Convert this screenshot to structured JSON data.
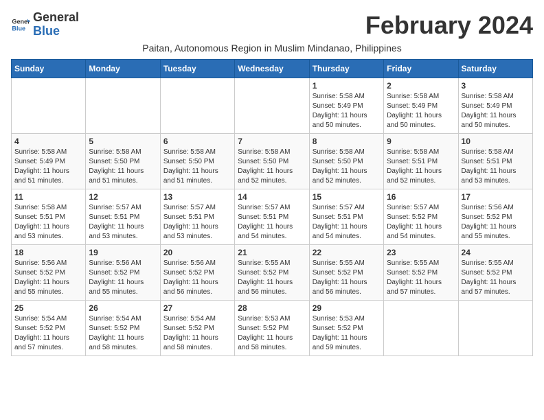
{
  "logo": {
    "general": "General",
    "blue": "Blue"
  },
  "month_title": "February 2024",
  "subtitle": "Paitan, Autonomous Region in Muslim Mindanao, Philippines",
  "days_of_week": [
    "Sunday",
    "Monday",
    "Tuesday",
    "Wednesday",
    "Thursday",
    "Friday",
    "Saturday"
  ],
  "weeks": [
    [
      {
        "num": "",
        "detail": ""
      },
      {
        "num": "",
        "detail": ""
      },
      {
        "num": "",
        "detail": ""
      },
      {
        "num": "",
        "detail": ""
      },
      {
        "num": "1",
        "detail": "Sunrise: 5:58 AM\nSunset: 5:49 PM\nDaylight: 11 hours\nand 50 minutes."
      },
      {
        "num": "2",
        "detail": "Sunrise: 5:58 AM\nSunset: 5:49 PM\nDaylight: 11 hours\nand 50 minutes."
      },
      {
        "num": "3",
        "detail": "Sunrise: 5:58 AM\nSunset: 5:49 PM\nDaylight: 11 hours\nand 50 minutes."
      }
    ],
    [
      {
        "num": "4",
        "detail": "Sunrise: 5:58 AM\nSunset: 5:49 PM\nDaylight: 11 hours\nand 51 minutes."
      },
      {
        "num": "5",
        "detail": "Sunrise: 5:58 AM\nSunset: 5:50 PM\nDaylight: 11 hours\nand 51 minutes."
      },
      {
        "num": "6",
        "detail": "Sunrise: 5:58 AM\nSunset: 5:50 PM\nDaylight: 11 hours\nand 51 minutes."
      },
      {
        "num": "7",
        "detail": "Sunrise: 5:58 AM\nSunset: 5:50 PM\nDaylight: 11 hours\nand 52 minutes."
      },
      {
        "num": "8",
        "detail": "Sunrise: 5:58 AM\nSunset: 5:50 PM\nDaylight: 11 hours\nand 52 minutes."
      },
      {
        "num": "9",
        "detail": "Sunrise: 5:58 AM\nSunset: 5:51 PM\nDaylight: 11 hours\nand 52 minutes."
      },
      {
        "num": "10",
        "detail": "Sunrise: 5:58 AM\nSunset: 5:51 PM\nDaylight: 11 hours\nand 53 minutes."
      }
    ],
    [
      {
        "num": "11",
        "detail": "Sunrise: 5:58 AM\nSunset: 5:51 PM\nDaylight: 11 hours\nand 53 minutes."
      },
      {
        "num": "12",
        "detail": "Sunrise: 5:57 AM\nSunset: 5:51 PM\nDaylight: 11 hours\nand 53 minutes."
      },
      {
        "num": "13",
        "detail": "Sunrise: 5:57 AM\nSunset: 5:51 PM\nDaylight: 11 hours\nand 53 minutes."
      },
      {
        "num": "14",
        "detail": "Sunrise: 5:57 AM\nSunset: 5:51 PM\nDaylight: 11 hours\nand 54 minutes."
      },
      {
        "num": "15",
        "detail": "Sunrise: 5:57 AM\nSunset: 5:51 PM\nDaylight: 11 hours\nand 54 minutes."
      },
      {
        "num": "16",
        "detail": "Sunrise: 5:57 AM\nSunset: 5:52 PM\nDaylight: 11 hours\nand 54 minutes."
      },
      {
        "num": "17",
        "detail": "Sunrise: 5:56 AM\nSunset: 5:52 PM\nDaylight: 11 hours\nand 55 minutes."
      }
    ],
    [
      {
        "num": "18",
        "detail": "Sunrise: 5:56 AM\nSunset: 5:52 PM\nDaylight: 11 hours\nand 55 minutes."
      },
      {
        "num": "19",
        "detail": "Sunrise: 5:56 AM\nSunset: 5:52 PM\nDaylight: 11 hours\nand 55 minutes."
      },
      {
        "num": "20",
        "detail": "Sunrise: 5:56 AM\nSunset: 5:52 PM\nDaylight: 11 hours\nand 56 minutes."
      },
      {
        "num": "21",
        "detail": "Sunrise: 5:55 AM\nSunset: 5:52 PM\nDaylight: 11 hours\nand 56 minutes."
      },
      {
        "num": "22",
        "detail": "Sunrise: 5:55 AM\nSunset: 5:52 PM\nDaylight: 11 hours\nand 56 minutes."
      },
      {
        "num": "23",
        "detail": "Sunrise: 5:55 AM\nSunset: 5:52 PM\nDaylight: 11 hours\nand 57 minutes."
      },
      {
        "num": "24",
        "detail": "Sunrise: 5:55 AM\nSunset: 5:52 PM\nDaylight: 11 hours\nand 57 minutes."
      }
    ],
    [
      {
        "num": "25",
        "detail": "Sunrise: 5:54 AM\nSunset: 5:52 PM\nDaylight: 11 hours\nand 57 minutes."
      },
      {
        "num": "26",
        "detail": "Sunrise: 5:54 AM\nSunset: 5:52 PM\nDaylight: 11 hours\nand 58 minutes."
      },
      {
        "num": "27",
        "detail": "Sunrise: 5:54 AM\nSunset: 5:52 PM\nDaylight: 11 hours\nand 58 minutes."
      },
      {
        "num": "28",
        "detail": "Sunrise: 5:53 AM\nSunset: 5:52 PM\nDaylight: 11 hours\nand 58 minutes."
      },
      {
        "num": "29",
        "detail": "Sunrise: 5:53 AM\nSunset: 5:52 PM\nDaylight: 11 hours\nand 59 minutes."
      },
      {
        "num": "",
        "detail": ""
      },
      {
        "num": "",
        "detail": ""
      }
    ]
  ]
}
